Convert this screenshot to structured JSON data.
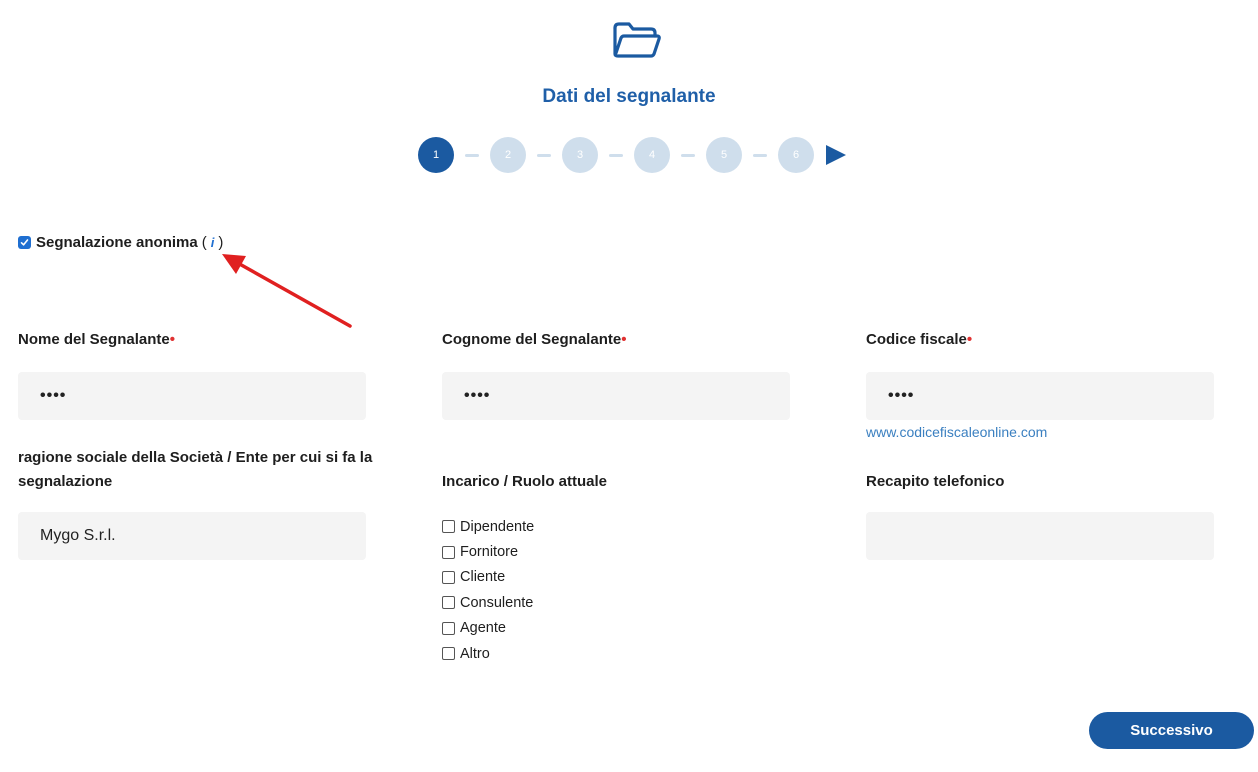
{
  "header": {
    "title": "Dati del segnalante",
    "icon": "folder-icon",
    "steps": [
      "1",
      "2",
      "3",
      "4",
      "5",
      "6"
    ],
    "active_step": 1
  },
  "anonymous": {
    "label": "Segnalazione anonima",
    "checked": true,
    "info_open": "(",
    "info_icon": "i",
    "info_close": ")"
  },
  "fields": {
    "nome": {
      "label": "Nome del Segnalante",
      "required": "•",
      "value": "••••"
    },
    "cognome": {
      "label": "Cognome del Segnalante",
      "required": "•",
      "value": "••••"
    },
    "codice": {
      "label": "Codice fiscale",
      "required": "•",
      "value": "••••"
    },
    "codice_link": "www.codicefiscaleonline.com",
    "ragione": {
      "label": "ragione sociale della Società / Ente per cui si fa la segnalazione",
      "value": "Mygo S.r.l."
    },
    "ruolo": {
      "label": "Incarico / Ruolo attuale",
      "options": [
        "Dipendente",
        "Fornitore",
        "Cliente",
        "Consulente",
        "Agente",
        "Altro"
      ]
    },
    "telefono": {
      "label": "Recapito telefonico",
      "value": ""
    }
  },
  "actions": {
    "next_label": "Successivo"
  },
  "colors": {
    "primary": "#1b5aa1",
    "step_inactive": "#cfdeec",
    "required": "#e03131",
    "arrow": "#e02020"
  }
}
